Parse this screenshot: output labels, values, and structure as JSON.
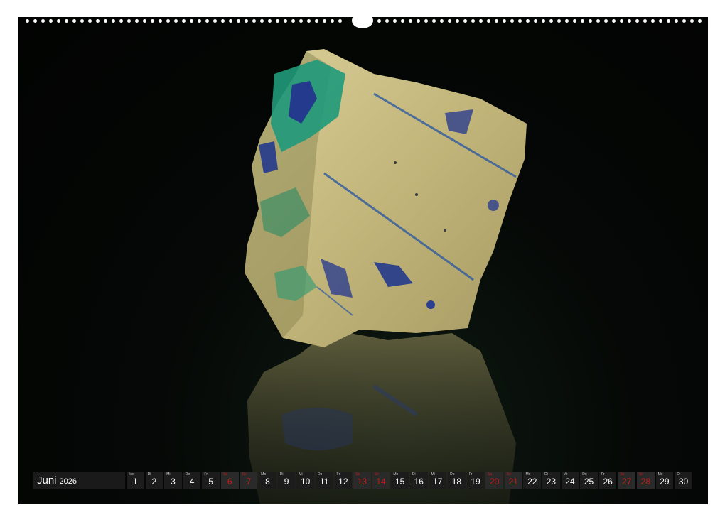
{
  "calendar": {
    "month": "Juni",
    "year": "2026",
    "days": [
      {
        "wd": "Mo",
        "n": "1",
        "weekend": false
      },
      {
        "wd": "Di",
        "n": "2",
        "weekend": false
      },
      {
        "wd": "Mi",
        "n": "3",
        "weekend": false
      },
      {
        "wd": "Do",
        "n": "4",
        "weekend": false
      },
      {
        "wd": "Fr",
        "n": "5",
        "weekend": false
      },
      {
        "wd": "Sa",
        "n": "6",
        "weekend": true
      },
      {
        "wd": "So",
        "n": "7",
        "weekend": true
      },
      {
        "wd": "Mo",
        "n": "8",
        "weekend": false
      },
      {
        "wd": "Di",
        "n": "9",
        "weekend": false
      },
      {
        "wd": "Mi",
        "n": "10",
        "weekend": false
      },
      {
        "wd": "Do",
        "n": "11",
        "weekend": false
      },
      {
        "wd": "Fr",
        "n": "12",
        "weekend": false
      },
      {
        "wd": "Sa",
        "n": "13",
        "weekend": true
      },
      {
        "wd": "So",
        "n": "14",
        "weekend": true
      },
      {
        "wd": "Mo",
        "n": "15",
        "weekend": false
      },
      {
        "wd": "Di",
        "n": "16",
        "weekend": false
      },
      {
        "wd": "Mi",
        "n": "17",
        "weekend": false
      },
      {
        "wd": "Do",
        "n": "18",
        "weekend": false
      },
      {
        "wd": "Fr",
        "n": "19",
        "weekend": false
      },
      {
        "wd": "Sa",
        "n": "20",
        "weekend": true
      },
      {
        "wd": "So",
        "n": "21",
        "weekend": true
      },
      {
        "wd": "Mo",
        "n": "22",
        "weekend": false
      },
      {
        "wd": "Di",
        "n": "23",
        "weekend": false
      },
      {
        "wd": "Mi",
        "n": "24",
        "weekend": false
      },
      {
        "wd": "Do",
        "n": "25",
        "weekend": false
      },
      {
        "wd": "Fr",
        "n": "26",
        "weekend": false
      },
      {
        "wd": "Sa",
        "n": "27",
        "weekend": true
      },
      {
        "wd": "So",
        "n": "28",
        "weekend": true
      },
      {
        "wd": "Mo",
        "n": "29",
        "weekend": false
      },
      {
        "wd": "Di",
        "n": "30",
        "weekend": false
      }
    ]
  },
  "colors": {
    "background": "#020302",
    "rock": "#c8bd86",
    "malachite": "#1f9a7a",
    "azurite": "#243a8c",
    "weekend_text": "#d01818"
  }
}
